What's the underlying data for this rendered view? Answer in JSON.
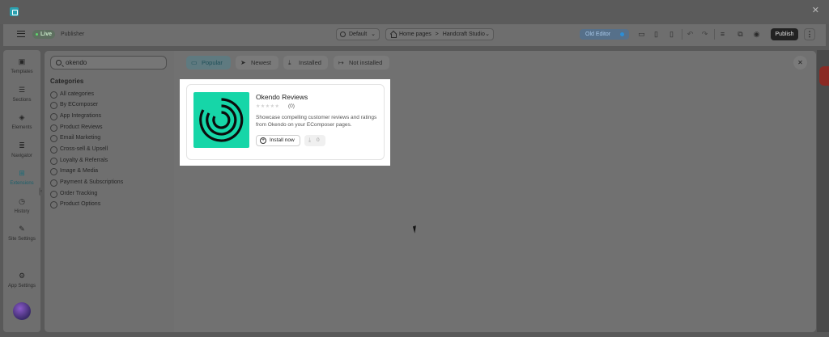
{
  "topbar": {
    "status": "Live",
    "role": "Publisher",
    "template_label": "Default",
    "breadcrumb": [
      "Home pages",
      "Handcraft Studio"
    ],
    "breadcrumb_sep": ">",
    "old_editor_label": "Old Editor",
    "publish_label": "Publish"
  },
  "leftbar": {
    "items": [
      {
        "label": "Templates",
        "icon": "templates-icon"
      },
      {
        "label": "Sections",
        "icon": "sections-icon"
      },
      {
        "label": "Elements",
        "icon": "elements-icon"
      },
      {
        "label": "Navigator",
        "icon": "navigator-icon"
      },
      {
        "label": "Extensions",
        "icon": "extensions-icon"
      },
      {
        "label": "History",
        "icon": "history-icon"
      },
      {
        "label": "Site Settings",
        "icon": "brush-icon"
      },
      {
        "label": "App Settings",
        "icon": "gear-icon"
      }
    ]
  },
  "modal": {
    "search": {
      "value": "okendo",
      "placeholder": "Search"
    },
    "categories_title": "Categories",
    "categories": [
      "All categories",
      "By EComposer",
      "App Integrations",
      "Product Reviews",
      "Email Marketing",
      "Cross-sell & Upsell",
      "Loyalty & Referrals",
      "Image & Media",
      "Payment & Subscriptions",
      "Order Tracking",
      "Product Options"
    ],
    "tabs": [
      {
        "label": "Popular",
        "icon": "popular-icon"
      },
      {
        "label": "Newest",
        "icon": "send-icon"
      },
      {
        "label": "Installed",
        "icon": "download-icon"
      },
      {
        "label": "Not installed",
        "icon": "exit-icon"
      }
    ],
    "active_tab": "Popular"
  },
  "extension_card": {
    "title": "Okendo Reviews",
    "rating_count": "(0)",
    "description": "Showcase compelling customer reviews and ratings from Okendo on your EComposer pages.",
    "install_label": "Install now",
    "downloads": "0",
    "logo_color": "#16d6a8"
  },
  "colors": {
    "accent": "#2aa1b0",
    "publish_bg": "#222222",
    "live_dot": "#5fd66c"
  }
}
